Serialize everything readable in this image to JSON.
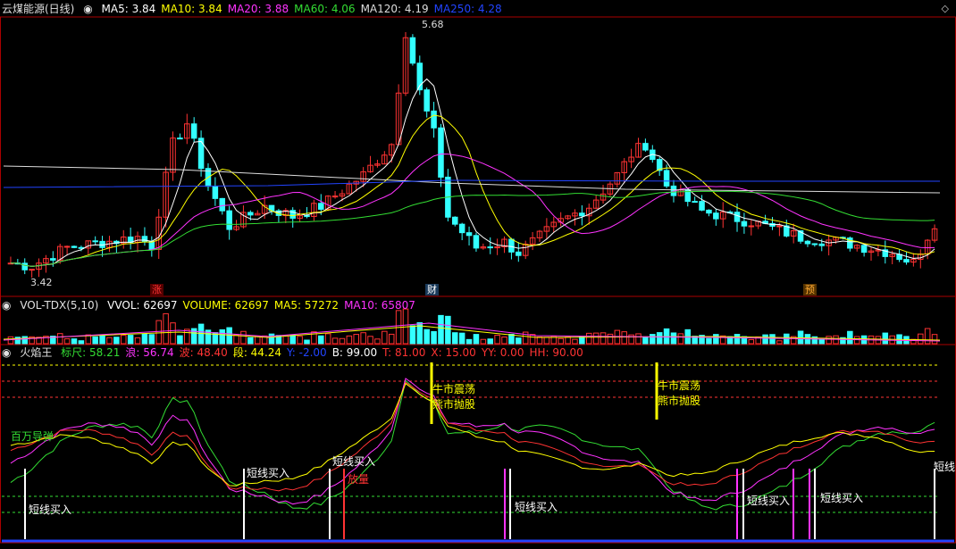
{
  "price_panel": {
    "title": "云煤能源(日线)",
    "indicators": [
      {
        "label": "MA5: 3.84",
        "color": "#ffffff"
      },
      {
        "label": "MA10: 3.84",
        "color": "#ffff00"
      },
      {
        "label": "MA20: 3.88",
        "color": "#ff33ff"
      },
      {
        "label": "MA60: 4.06",
        "color": "#33dd33"
      },
      {
        "label": "MA120: 4.19",
        "color": "#dddddd"
      },
      {
        "label": "MA250: 4.28",
        "color": "#2244ff"
      }
    ],
    "high_label": "5.68",
    "low_label": "3.42",
    "markers": [
      {
        "text": "涨",
        "color": "#ff3333",
        "bg": "#550000"
      },
      {
        "text": "财",
        "color": "#ffffff",
        "bg": "#1a3a5a"
      },
      {
        "text": "预",
        "color": "#ffaa33",
        "bg": "#553300"
      }
    ]
  },
  "volume_panel": {
    "name": "VOL-TDX(5,10)",
    "values": [
      {
        "label": "VVOL: 62697",
        "color": "#ffffff"
      },
      {
        "label": "VOLUME: 62697",
        "color": "#ffff00"
      },
      {
        "label": "MA5: 57272",
        "color": "#ffff00"
      },
      {
        "label": "MA10: 65807",
        "color": "#ff33ff"
      }
    ]
  },
  "indicator_panel": {
    "name": "火焰王",
    "values": [
      {
        "label": "标尺: 58.21",
        "color": "#33dd33"
      },
      {
        "label": "浪: 56.74",
        "color": "#ff33ff"
      },
      {
        "label": "波: 48.40",
        "color": "#ff3333"
      },
      {
        "label": "段: 44.24",
        "color": "#ffff00"
      },
      {
        "label": "Y: -2.00",
        "color": "#2244ff"
      },
      {
        "label": "B: 99.00",
        "color": "#ffffff"
      },
      {
        "label": "T: 81.00",
        "color": "#ff3333"
      },
      {
        "label": "X: 15.00",
        "color": "#ff3333"
      },
      {
        "label": "YY: 0.00",
        "color": "#ff3333"
      },
      {
        "label": "HH: 90.00",
        "color": "#ff3333"
      }
    ],
    "annotations": {
      "bomb": "百万导弹",
      "short_buy": "短线买入",
      "bull_shock": "牛市震荡",
      "bear_sell": "熊市抛股",
      "volume_up": "放量",
      "short": "短线"
    }
  },
  "colors": {
    "up": "#ff3333",
    "down": "#33ffff",
    "ma5": "#ffffff",
    "ma10": "#ffff00",
    "ma20": "#ff33ff",
    "ma60": "#33dd33",
    "ma120": "#dddddd",
    "ma250": "#2244ff",
    "border": "#aa0000"
  }
}
